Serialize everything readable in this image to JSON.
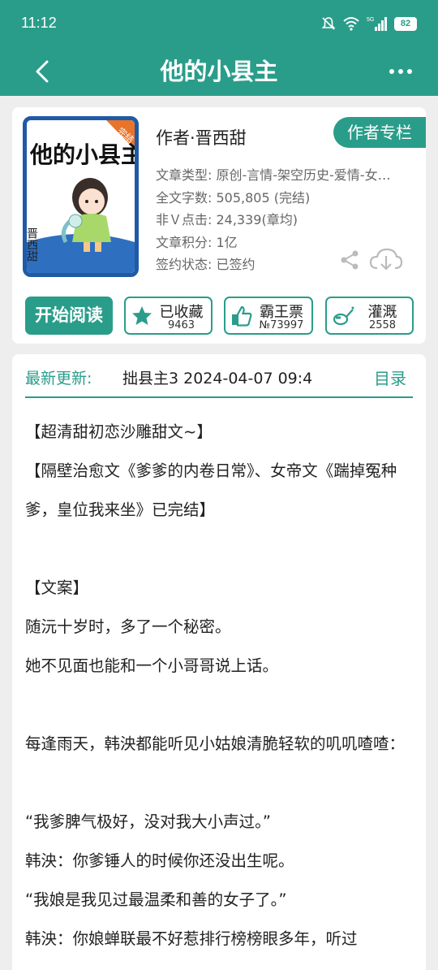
{
  "status": {
    "time": "11:12",
    "network": "5G",
    "battery": "82"
  },
  "header": {
    "title": "他的小县主"
  },
  "book": {
    "cover_badge": "完结",
    "cover_title": "他的小县主",
    "cover_author": "晋西甜",
    "author_line": "作者·晋西甜",
    "author_column_label": "作者专栏",
    "meta": [
      {
        "label": "文章类型: ",
        "value": "原创-言情-架空历史-爱情-女…"
      },
      {
        "label": "全文字数: ",
        "value": "505,805 (完结)"
      },
      {
        "label": "非Ｖ点击: ",
        "value": "24,339(章均)"
      },
      {
        "label": "文章积分: ",
        "value": "1亿"
      },
      {
        "label": "签约状态: ",
        "value": "已签约"
      }
    ],
    "read_button": "开始阅读",
    "actions": [
      {
        "icon": "star-icon",
        "label": "已收藏",
        "count": "9463"
      },
      {
        "icon": "thumbs-up-icon",
        "label": "霸王票",
        "count": "№73997"
      },
      {
        "icon": "watering-can-icon",
        "label": "灌溉",
        "count": "2558"
      }
    ],
    "accent_color": "#2a9d8a"
  },
  "update": {
    "label": "最新更新:",
    "text": "拙县主3  2024-04-07 09:4",
    "catalog_label": "目录"
  },
  "intro": [
    "【超清甜初恋沙雕甜文~】",
    "【隔壁治愈文《爹爹的内卷日常》、女帝文《踹掉冤种爹，皇位我来坐》已完结】",
    "",
    "【文案】",
    "随沅十岁时，多了一个秘密。",
    "她不见面也能和一个小哥哥说上话。",
    "",
    "每逢雨天，韩泱都能听见小姑娘清脆轻软的叽叽喳喳：",
    "",
    " “我爹脾气极好，没对我大小声过。”",
    "韩泱：你爹锤人的时候你还没出生呢。",
    "“我娘是我见过最温柔和善的女子了。”",
    "韩泱：你娘蝉联最不好惹排行榜榜眼多年，听过"
  ]
}
